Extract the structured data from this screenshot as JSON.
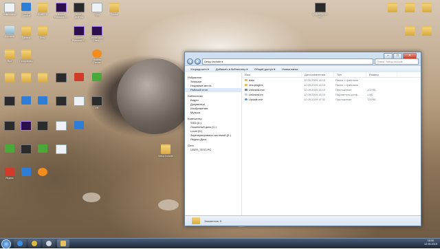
{
  "desktop": {
    "icons": [
      {
        "label": "Компьютер",
        "type": "white"
      },
      {
        "label": "Google Chrome",
        "type": "blue"
      },
      {
        "label": "Mobil PC",
        "type": "folder"
      },
      {
        "label": "Adobe Premiere P...",
        "type": "purple"
      },
      {
        "label": "КИНО ДОГМА",
        "type": "app"
      },
      {
        "label": "1.jpg",
        "type": "white"
      },
      {
        "label": "Папка",
        "type": "folder"
      },
      {
        "label": "Корзина",
        "type": "recycle"
      },
      {
        "label": "Записи",
        "type": "folder"
      },
      {
        "label": "Фото",
        "type": "folder"
      },
      {
        "label": "Adobe Premiere P...",
        "type": "purple"
      },
      {
        "label": "Adobe After Effec...",
        "type": "purple"
      },
      {
        "label": "Ярл",
        "type": "folder"
      },
      {
        "label": "Программы",
        "type": "folder"
      },
      {
        "label": "Mozilla Firefox",
        "type": "orange"
      },
      {
        "label": "VR",
        "type": "app"
      },
      {
        "label": "USER_TEST-PC",
        "type": "app"
      },
      {
        "label": "USER_TEST-PC",
        "type": "folder"
      },
      {
        "label": "Яндекс",
        "type": "red"
      },
      {
        "label": "Intel",
        "type": "blue"
      },
      {
        "label": "Setup Include",
        "type": "folder"
      }
    ]
  },
  "window": {
    "address_path": "Setup Include ▸",
    "search_placeholder": "Поиск: Setup Include",
    "nav_back": "◀",
    "nav_forward": "▶",
    "buttons": {
      "minimize": "–",
      "maximize": "□",
      "close": "✕"
    },
    "toolbar": [
      "Упорядочить ▾",
      "Добавить в библиотеку ▾",
      "Общий доступ ▾",
      "Новая папка"
    ],
    "nav_pane": [
      {
        "label": "Избранное",
        "group": true,
        "selected": false
      },
      {
        "label": "Загрузки",
        "group": false,
        "selected": false
      },
      {
        "label": "Недавние места",
        "group": false,
        "selected": false
      },
      {
        "label": "Рабочий стол",
        "group": false,
        "selected": true
      },
      {
        "label": "Библиотеки",
        "group": true,
        "selected": false
      },
      {
        "label": "Видео",
        "group": false,
        "selected": false
      },
      {
        "label": "Документы",
        "group": false,
        "selected": false
      },
      {
        "label": "Изображения",
        "group": false,
        "selected": false
      },
      {
        "label": "Музыка",
        "group": false,
        "selected": false
      },
      {
        "label": "Компьютер",
        "group": true,
        "selected": false
      },
      {
        "label": "SSD (A:)",
        "group": false,
        "selected": false
      },
      {
        "label": "Локальный диск (C:)",
        "group": false,
        "selected": false
      },
      {
        "label": "Local (D:)",
        "group": false,
        "selected": false
      },
      {
        "label": "Зарезервировано системой (E:)",
        "group": false,
        "selected": false
      },
      {
        "label": "Яндекс.Диск",
        "group": false,
        "selected": false
      },
      {
        "label": "Сеть",
        "group": true,
        "selected": false
      },
      {
        "label": "USER_TEST-PC",
        "group": false,
        "selected": false
      }
    ],
    "columns": [
      "Имя",
      "Дата изменения",
      "Тип",
      "Размер"
    ],
    "files": [
      {
        "name": "data",
        "date": "12.05.2019 18:10",
        "type": "Папка с файлами",
        "size": "",
        "kind": "folder"
      },
      {
        "name": "obs-plugins",
        "date": "12.05.2019 18:10",
        "type": "Папка с файлами",
        "size": "",
        "kind": "folder"
      },
      {
        "name": "Uninstall.exe",
        "date": "12.05.2019 18:10",
        "type": "Приложение",
        "size": "102 КБ",
        "kind": "exe"
      },
      {
        "name": "Uninstall.ini",
        "date": "12.05.2019 18:10",
        "type": "Параметры конф...",
        "size": "1 КБ",
        "kind": "dat"
      },
      {
        "name": "Update.exe",
        "date": "12.05.2019 17:31",
        "type": "Приложение",
        "size": "725 КБ",
        "kind": "exe2"
      }
    ],
    "status": "Элементов: 5"
  },
  "taskbar": {
    "items": [
      "start",
      "ie",
      "chrome",
      "explorer-1",
      "explorer-2"
    ],
    "time": "18:30",
    "date": "12.05.2019"
  }
}
